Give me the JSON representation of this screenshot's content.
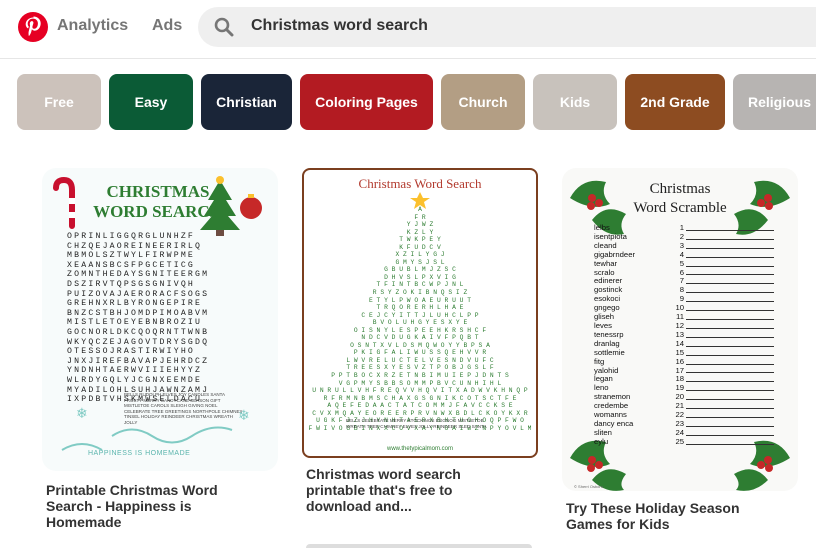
{
  "header": {
    "nav_analytics": "Analytics",
    "nav_ads": "Ads",
    "search_value": "Christmas word search"
  },
  "chips": [
    {
      "label": "Free",
      "color": "#ccc2bb"
    },
    {
      "label": "Easy",
      "color": "#0b5b36"
    },
    {
      "label": "Christian",
      "color": "#1a2538"
    },
    {
      "label": "Coloring Pages",
      "color": "#b31b22"
    },
    {
      "label": "Church",
      "color": "#b39e84"
    },
    {
      "label": "Kids",
      "color": "#c8c2bc"
    },
    {
      "label": "2nd Grade",
      "color": "#8d4c21"
    },
    {
      "label": "Religious",
      "color": "#b7b4b2"
    }
  ],
  "pins": [
    {
      "title": "Printable Christmas Word Search - Happiness is Homemade",
      "image": {
        "heading_1": "CHRISTMAS",
        "heading_2": "WORD SEARCH",
        "grid": [
          "OPRINLIGGQRGLUNHZF",
          "CHZQEJAOREINEERIRLQ",
          "MBMOLSZTWYLFIRWPME",
          "XEAANSBCSFPGCETICG",
          "ZOMNTHEDAYSGNITEERGM",
          "DSZIRVTQPSGSGNIVQH",
          "PUIZOVAJAERORACFSOGS",
          "GREHNXRLBYRONGEPIRE",
          "BNZCSTBHJOMDPIMOABVM",
          "MISTLETOEYEBNBROZIU",
          "GOCNORLDKCQOQRNTTWNB",
          "WKYQCZEJAGOVTDRYSGDQ",
          "OTESSOJRASTIRWIYHO",
          "JNXJIREFBAVAPJEHRDCZ",
          "YNDNHTAERWVIIIEHYYZ",
          "WLRDYGQLYJCGNXEEMDE",
          "MYADILOHLSUHJAWNZAMJ",
          "IXPDBTVHSKMWSELDACU"
        ],
        "words": "BELLS RUDOLPH ELVES JOY CANDLES SANTA FROSTY MERRY CANDYCANE SEASON GIFT MISTLETOE CAROLS SLEIGH GIVING NOEL CELEBRATE TREE GREETINGS NORTHPOLE CHIMNEY TINSEL HOLIDAY REINDEER CHRISTMAS WREATH JOLLY",
        "footer": "HAPPINESS IS HOMEMADE"
      }
    },
    {
      "title": "Christmas word search printable that's free to download and...",
      "image": {
        "heading": "Christmas Word Search",
        "tree": [
          "A",
          "F R",
          "Y J W Z",
          "K Z L Y",
          "T W K P E Y",
          "K F U D C V",
          "X Z I L Y G J",
          "G M Y S J S L",
          "G B U B L M J Z S C",
          "D H V S L P X V I G",
          "T F I N T B C W P J N L",
          "R S Y Z O K I B N Q S I Z",
          "E T Y L P W O A E U R U U T",
          "T R Q O R E R H L H A E",
          "C E J C Y I T T J L U H C L P P",
          "B V O L U H G Y E S X Y E",
          "O I S N Y L E S P E E H K R S H C F",
          "N D C V D U G K A I V F P Q B T",
          "O S N T X V L D S M Q W O Y Y B P S A",
          "P K I G F A L I W U S S Q E H V V R",
          "L W V R E L U C T E L V E S N D V U F C",
          "T R E E S X Y E S V Z T P O B J G S L F",
          "P P T B O C X R Z E T N B I M U I E P J D N T S",
          "V G P M Y S B B S O M M P B V C U N H I H L",
          "U N R U L L V H F R E Q V V H Q V I T X A D W V K H N Q P",
          "R F R M N B M S C H A X G S G N I K C O T S C T F E",
          "A Q E F E D A A C T A T C O M M J F A V C C K S E",
          "C V X M Q A Y E O R E E R P R V N W X B D L C K O Y K X R",
          "U G K F J Z J H Y N H T A E R X B H T U O H O Q P F W O",
          "F W I V O G B I N X X C O V X A Y N O A I W Z N P Y O V L M"
        ],
        "words": "BELLS CELEBRATE MERRY STOCKINGS EGGNOG MISTLETOE WREATH TREE CHIMNEY ELVES JOLLY REINDEER SLED SANTA",
        "footer": "www.thetypicalmom.com"
      }
    },
    {
      "title": "Try These Holiday Season Games for Kids",
      "image": {
        "heading_1": "Christmas",
        "heading_2": "Word Scramble",
        "items": [
          {
            "word": "lelbs",
            "n": "1"
          },
          {
            "word": "isentpiota",
            "n": "2"
          },
          {
            "word": "cleand",
            "n": "3"
          },
          {
            "word": "gigabrndeer",
            "n": "4"
          },
          {
            "word": "tewhar",
            "n": "5"
          },
          {
            "word": "scralo",
            "n": "6"
          },
          {
            "word": "edinerer",
            "n": "7"
          },
          {
            "word": "gostinck",
            "n": "8"
          },
          {
            "word": "esokoci",
            "n": "9"
          },
          {
            "word": "gngego",
            "n": "10"
          },
          {
            "word": "gliseh",
            "n": "11"
          },
          {
            "word": "leves",
            "n": "12"
          },
          {
            "word": "tenessrp",
            "n": "13"
          },
          {
            "word": "dranlag",
            "n": "14"
          },
          {
            "word": "sottlemie",
            "n": "15"
          },
          {
            "word": "fitg",
            "n": "16"
          },
          {
            "word": "yalohid",
            "n": "17"
          },
          {
            "word": "legan",
            "n": "18"
          },
          {
            "word": "leno",
            "n": "19"
          },
          {
            "word": "stranemon",
            "n": "20"
          },
          {
            "word": "credembe",
            "n": "21"
          },
          {
            "word": "womanns",
            "n": "22"
          },
          {
            "word": "dancy enca",
            "n": "23"
          },
          {
            "word": "sliten",
            "n": "24"
          },
          {
            "word": "eylu",
            "n": "25"
          }
        ],
        "credit": "© Sherri Osborn"
      }
    }
  ]
}
